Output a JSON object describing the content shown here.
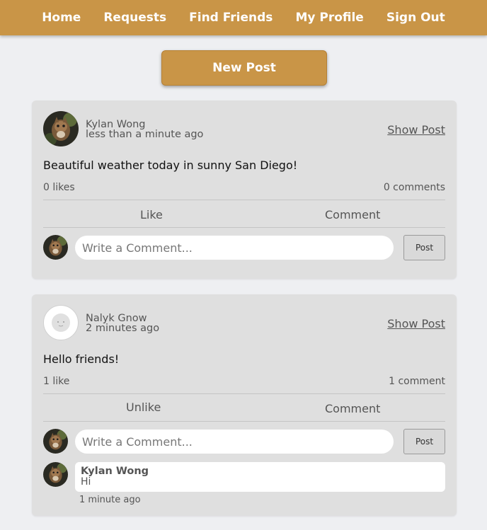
{
  "nav": {
    "items": [
      "Home",
      "Requests",
      "Find Friends",
      "My Profile",
      "Sign Out"
    ]
  },
  "new_post_label": "New Post",
  "posts": [
    {
      "author": "Kylan Wong",
      "time": "less than a minute ago",
      "show_post_label": "Show Post",
      "body": "Beautiful weather today in sunny San Diego!",
      "likes": "0 likes",
      "comments_count": "0 comments",
      "like_action": "Like",
      "comment_action": "Comment",
      "comment_placeholder": "Write a Comment...",
      "post_button": "Post"
    },
    {
      "author": "Nalyk Gnow",
      "time": "2 minutes ago",
      "show_post_label": "Show Post",
      "body": "Hello friends!",
      "likes": "1 like",
      "comments_count": "1 comment",
      "like_action": "Unlike",
      "comment_action": "Comment",
      "comment_placeholder": "Write a Comment...",
      "post_button": "Post",
      "comments": [
        {
          "author": "Kylan Wong",
          "text": "Hi",
          "time": "1 minute ago"
        }
      ]
    }
  ],
  "colors": {
    "accent": "#c99547",
    "background": "#eeeff2",
    "card": "#dfdfdf"
  }
}
